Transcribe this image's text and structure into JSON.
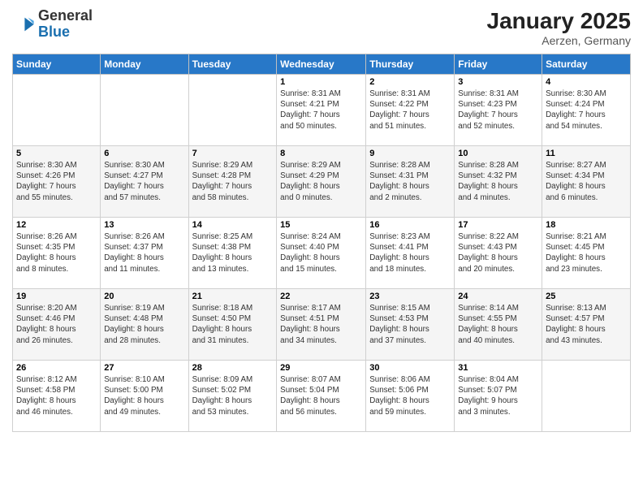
{
  "header": {
    "logo_general": "General",
    "logo_blue": "Blue",
    "month_title": "January 2025",
    "location": "Aerzen, Germany"
  },
  "weekdays": [
    "Sunday",
    "Monday",
    "Tuesday",
    "Wednesday",
    "Thursday",
    "Friday",
    "Saturday"
  ],
  "weeks": [
    [
      {
        "day": "",
        "info": ""
      },
      {
        "day": "",
        "info": ""
      },
      {
        "day": "",
        "info": ""
      },
      {
        "day": "1",
        "info": "Sunrise: 8:31 AM\nSunset: 4:21 PM\nDaylight: 7 hours\nand 50 minutes."
      },
      {
        "day": "2",
        "info": "Sunrise: 8:31 AM\nSunset: 4:22 PM\nDaylight: 7 hours\nand 51 minutes."
      },
      {
        "day": "3",
        "info": "Sunrise: 8:31 AM\nSunset: 4:23 PM\nDaylight: 7 hours\nand 52 minutes."
      },
      {
        "day": "4",
        "info": "Sunrise: 8:30 AM\nSunset: 4:24 PM\nDaylight: 7 hours\nand 54 minutes."
      }
    ],
    [
      {
        "day": "5",
        "info": "Sunrise: 8:30 AM\nSunset: 4:26 PM\nDaylight: 7 hours\nand 55 minutes."
      },
      {
        "day": "6",
        "info": "Sunrise: 8:30 AM\nSunset: 4:27 PM\nDaylight: 7 hours\nand 57 minutes."
      },
      {
        "day": "7",
        "info": "Sunrise: 8:29 AM\nSunset: 4:28 PM\nDaylight: 7 hours\nand 58 minutes."
      },
      {
        "day": "8",
        "info": "Sunrise: 8:29 AM\nSunset: 4:29 PM\nDaylight: 8 hours\nand 0 minutes."
      },
      {
        "day": "9",
        "info": "Sunrise: 8:28 AM\nSunset: 4:31 PM\nDaylight: 8 hours\nand 2 minutes."
      },
      {
        "day": "10",
        "info": "Sunrise: 8:28 AM\nSunset: 4:32 PM\nDaylight: 8 hours\nand 4 minutes."
      },
      {
        "day": "11",
        "info": "Sunrise: 8:27 AM\nSunset: 4:34 PM\nDaylight: 8 hours\nand 6 minutes."
      }
    ],
    [
      {
        "day": "12",
        "info": "Sunrise: 8:26 AM\nSunset: 4:35 PM\nDaylight: 8 hours\nand 8 minutes."
      },
      {
        "day": "13",
        "info": "Sunrise: 8:26 AM\nSunset: 4:37 PM\nDaylight: 8 hours\nand 11 minutes."
      },
      {
        "day": "14",
        "info": "Sunrise: 8:25 AM\nSunset: 4:38 PM\nDaylight: 8 hours\nand 13 minutes."
      },
      {
        "day": "15",
        "info": "Sunrise: 8:24 AM\nSunset: 4:40 PM\nDaylight: 8 hours\nand 15 minutes."
      },
      {
        "day": "16",
        "info": "Sunrise: 8:23 AM\nSunset: 4:41 PM\nDaylight: 8 hours\nand 18 minutes."
      },
      {
        "day": "17",
        "info": "Sunrise: 8:22 AM\nSunset: 4:43 PM\nDaylight: 8 hours\nand 20 minutes."
      },
      {
        "day": "18",
        "info": "Sunrise: 8:21 AM\nSunset: 4:45 PM\nDaylight: 8 hours\nand 23 minutes."
      }
    ],
    [
      {
        "day": "19",
        "info": "Sunrise: 8:20 AM\nSunset: 4:46 PM\nDaylight: 8 hours\nand 26 minutes."
      },
      {
        "day": "20",
        "info": "Sunrise: 8:19 AM\nSunset: 4:48 PM\nDaylight: 8 hours\nand 28 minutes."
      },
      {
        "day": "21",
        "info": "Sunrise: 8:18 AM\nSunset: 4:50 PM\nDaylight: 8 hours\nand 31 minutes."
      },
      {
        "day": "22",
        "info": "Sunrise: 8:17 AM\nSunset: 4:51 PM\nDaylight: 8 hours\nand 34 minutes."
      },
      {
        "day": "23",
        "info": "Sunrise: 8:15 AM\nSunset: 4:53 PM\nDaylight: 8 hours\nand 37 minutes."
      },
      {
        "day": "24",
        "info": "Sunrise: 8:14 AM\nSunset: 4:55 PM\nDaylight: 8 hours\nand 40 minutes."
      },
      {
        "day": "25",
        "info": "Sunrise: 8:13 AM\nSunset: 4:57 PM\nDaylight: 8 hours\nand 43 minutes."
      }
    ],
    [
      {
        "day": "26",
        "info": "Sunrise: 8:12 AM\nSunset: 4:58 PM\nDaylight: 8 hours\nand 46 minutes."
      },
      {
        "day": "27",
        "info": "Sunrise: 8:10 AM\nSunset: 5:00 PM\nDaylight: 8 hours\nand 49 minutes."
      },
      {
        "day": "28",
        "info": "Sunrise: 8:09 AM\nSunset: 5:02 PM\nDaylight: 8 hours\nand 53 minutes."
      },
      {
        "day": "29",
        "info": "Sunrise: 8:07 AM\nSunset: 5:04 PM\nDaylight: 8 hours\nand 56 minutes."
      },
      {
        "day": "30",
        "info": "Sunrise: 8:06 AM\nSunset: 5:06 PM\nDaylight: 8 hours\nand 59 minutes."
      },
      {
        "day": "31",
        "info": "Sunrise: 8:04 AM\nSunset: 5:07 PM\nDaylight: 9 hours\nand 3 minutes."
      },
      {
        "day": "",
        "info": ""
      }
    ]
  ]
}
